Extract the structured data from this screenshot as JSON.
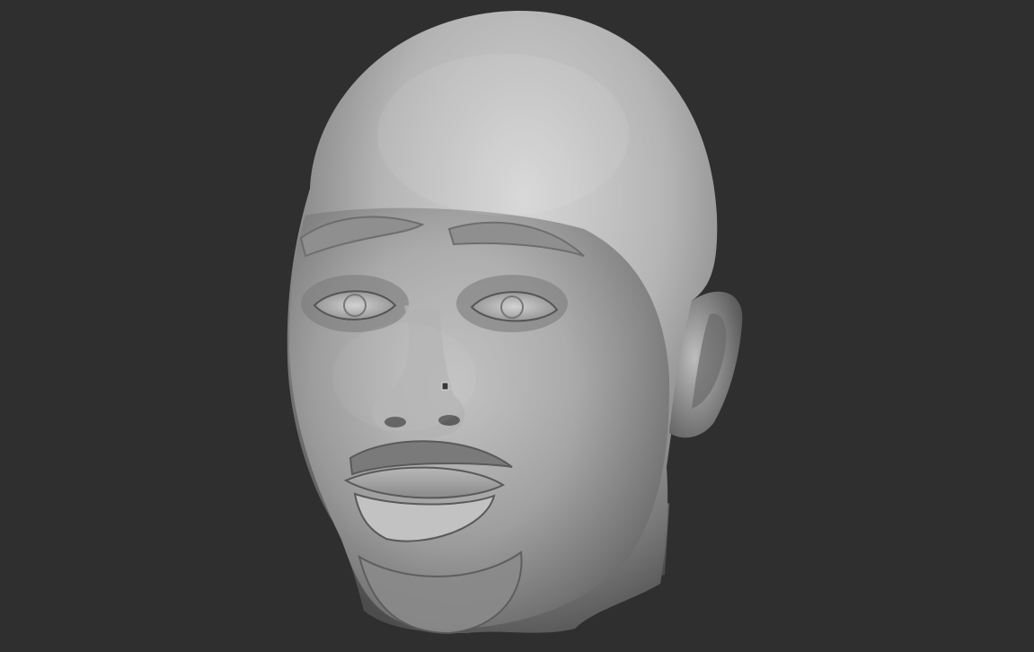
{
  "scene": {
    "subject": "sculpted-head",
    "colors": {
      "background": "#2f2f2f",
      "material_light": "#cfcfcf",
      "material_mid": "#9a9a9a",
      "material_dark": "#4a4a4a"
    }
  }
}
